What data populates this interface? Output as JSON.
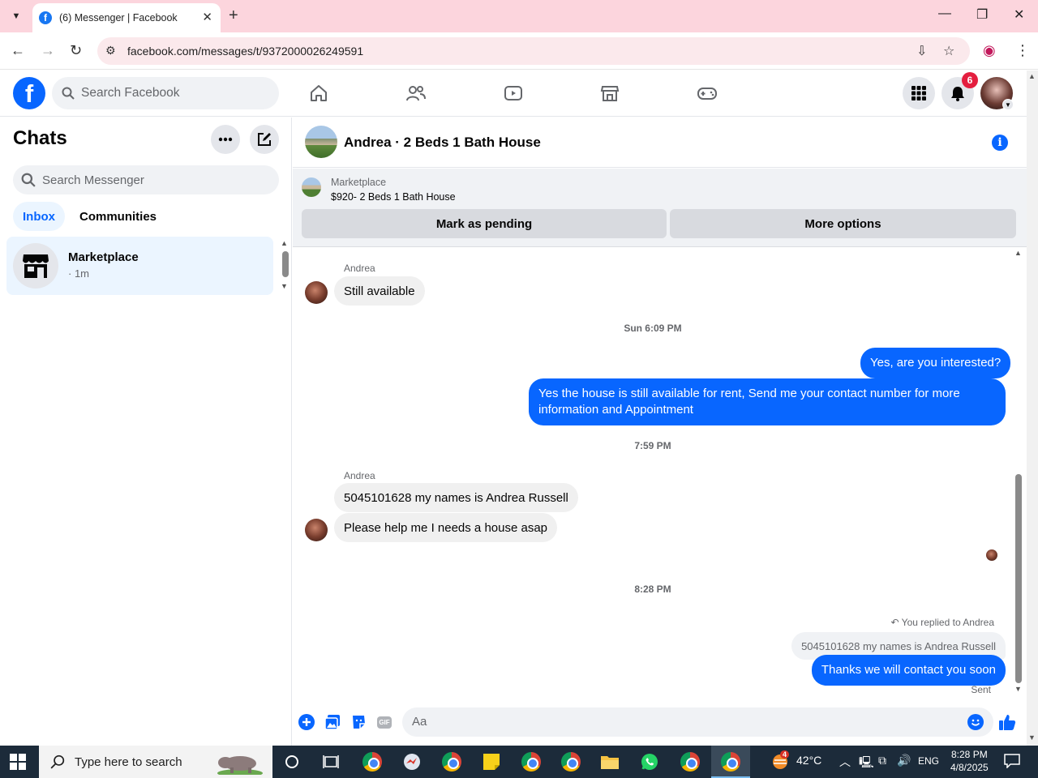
{
  "browser": {
    "tab_title": "(6) Messenger | Facebook",
    "url": "facebook.com/messages/t/9372000026249591"
  },
  "fb": {
    "search_placeholder": "Search Facebook",
    "notification_count": "6"
  },
  "chats": {
    "title": "Chats",
    "search_placeholder": "Search Messenger",
    "tabs": [
      "Inbox",
      "Communities"
    ],
    "items": [
      {
        "name": "Marketplace",
        "time": "· 1m"
      }
    ]
  },
  "conversation": {
    "title": "Andrea · 2 Beds 1 Bath House",
    "marketplace_label": "Marketplace",
    "listing": "$920- 2 Beds 1 Bath House",
    "mark_pending": "Mark as pending",
    "more_options": "More options",
    "messages": [
      {
        "sender": "Andrea",
        "text": "Still available"
      },
      {
        "stamp": "Sun 6:09 PM"
      },
      {
        "text": "Yes, are you interested?"
      },
      {
        "text": "Yes the house is still available for rent, Send me your contact number for more information and Appointment"
      },
      {
        "stamp": "7:59 PM"
      },
      {
        "sender": "Andrea",
        "text": "5045101628 my names is Andrea Russell"
      },
      {
        "text": "Please help me I needs a house asap"
      },
      {
        "stamp": "8:28 PM"
      },
      {
        "reply_note": "You replied to Andrea",
        "quoted": "5045101628 my names is Andrea Russell",
        "text": "Thanks we will contact you soon",
        "status": "Sent"
      }
    ],
    "composer_placeholder": "Aa"
  },
  "taskbar": {
    "search_placeholder": "Type here to search",
    "weather": "42°C",
    "language": "ENG",
    "time": "8:28 PM",
    "date": "4/8/2025",
    "weather_badge": "4"
  }
}
